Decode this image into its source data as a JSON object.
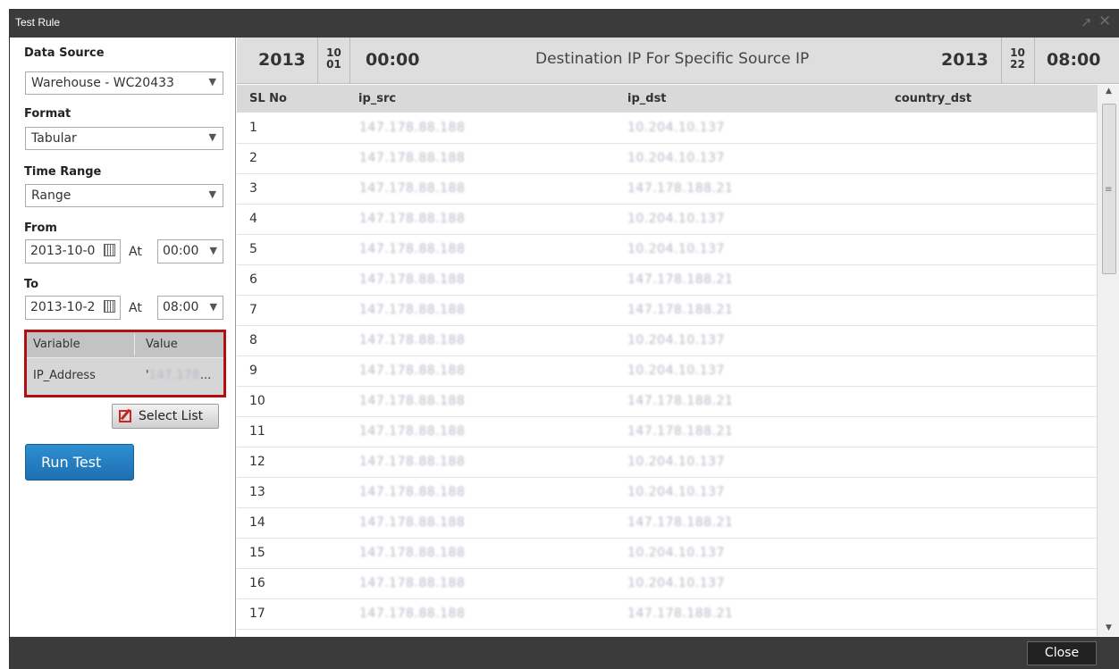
{
  "window": {
    "title": "Test Rule"
  },
  "left_panel": {
    "data_source": {
      "label": "Data Source",
      "value": "Warehouse - WC20433"
    },
    "format": {
      "label": "Format",
      "value": "Tabular"
    },
    "time_range": {
      "label": "Time Range",
      "value": "Range"
    },
    "from": {
      "label": "From",
      "date": "2013-10-0",
      "at": "At",
      "time": "00:00"
    },
    "to": {
      "label": "To",
      "date": "2013-10-2",
      "at": "At",
      "time": "08:00"
    },
    "variables": {
      "headers": [
        "Variable",
        "Value"
      ],
      "rows": [
        {
          "variable": "IP_Address",
          "value_prefix": "'",
          "value_blurred": "147.178",
          "value_suffix": "..."
        }
      ]
    },
    "select_list_label": "Select List",
    "run_test_label": "Run Test"
  },
  "info_bar": {
    "start_year": "2013",
    "start_month": "10",
    "start_day": "01",
    "start_time": "00:00",
    "title": "Destination IP For Specific Source IP",
    "end_year": "2013",
    "end_month": "10",
    "end_day": "22",
    "end_time": "08:00"
  },
  "table": {
    "headers": [
      "SL No",
      "ip_src",
      "ip_dst",
      "country_dst"
    ],
    "rows": [
      {
        "sl": "1",
        "ip_src": "147.178.88.188",
        "ip_dst": "10.204.10.137",
        "country_dst": ""
      },
      {
        "sl": "2",
        "ip_src": "147.178.88.188",
        "ip_dst": "10.204.10.137",
        "country_dst": ""
      },
      {
        "sl": "3",
        "ip_src": "147.178.88.188",
        "ip_dst": "147.178.188.21",
        "country_dst": ""
      },
      {
        "sl": "4",
        "ip_src": "147.178.88.188",
        "ip_dst": "10.204.10.137",
        "country_dst": ""
      },
      {
        "sl": "5",
        "ip_src": "147.178.88.188",
        "ip_dst": "10.204.10.137",
        "country_dst": ""
      },
      {
        "sl": "6",
        "ip_src": "147.178.88.188",
        "ip_dst": "147.178.188.21",
        "country_dst": ""
      },
      {
        "sl": "7",
        "ip_src": "147.178.88.188",
        "ip_dst": "147.178.188.21",
        "country_dst": ""
      },
      {
        "sl": "8",
        "ip_src": "147.178.88.188",
        "ip_dst": "10.204.10.137",
        "country_dst": ""
      },
      {
        "sl": "9",
        "ip_src": "147.178.88.188",
        "ip_dst": "10.204.10.137",
        "country_dst": ""
      },
      {
        "sl": "10",
        "ip_src": "147.178.88.188",
        "ip_dst": "147.178.188.21",
        "country_dst": ""
      },
      {
        "sl": "11",
        "ip_src": "147.178.88.188",
        "ip_dst": "147.178.188.21",
        "country_dst": ""
      },
      {
        "sl": "12",
        "ip_src": "147.178.88.188",
        "ip_dst": "10.204.10.137",
        "country_dst": ""
      },
      {
        "sl": "13",
        "ip_src": "147.178.88.188",
        "ip_dst": "10.204.10.137",
        "country_dst": ""
      },
      {
        "sl": "14",
        "ip_src": "147.178.88.188",
        "ip_dst": "147.178.188.21",
        "country_dst": ""
      },
      {
        "sl": "15",
        "ip_src": "147.178.88.188",
        "ip_dst": "10.204.10.137",
        "country_dst": ""
      },
      {
        "sl": "16",
        "ip_src": "147.178.88.188",
        "ip_dst": "10.204.10.137",
        "country_dst": ""
      },
      {
        "sl": "17",
        "ip_src": "147.178.88.188",
        "ip_dst": "147.178.188.21",
        "country_dst": ""
      }
    ]
  },
  "footer": {
    "close_label": "Close"
  },
  "icons": {
    "expand": "expand-icon",
    "close": "close-x-icon",
    "calendar": "calendar-icon",
    "edit": "edit-icon",
    "dropdown": "chevron-down-icon"
  },
  "colors": {
    "titlebar": "#3b3b3b",
    "highlight_border": "#b30f0f",
    "run_button": "#1d6fb0"
  }
}
